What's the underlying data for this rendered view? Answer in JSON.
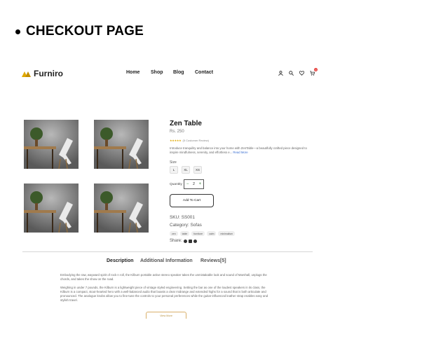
{
  "slide": {
    "title": "CHECKOUT PAGE"
  },
  "header": {
    "logo": "Furniro",
    "nav": [
      "Home",
      "Shop",
      "Blog",
      "Contact"
    ],
    "icons": [
      "user-icon",
      "search-icon",
      "heart-icon",
      "cart-icon"
    ],
    "cart_count": "0"
  },
  "product": {
    "title": "Zen Table",
    "price": "Rs. 250",
    "stars": "★★★★★",
    "reviews": "(5 Customer Review)",
    "description": "Introduce tranquility and balance into your home with ZenTable—a beautifully crafted piece designed to inspire mindfulness, serenity, and effortless e...",
    "read_more": "Read More",
    "size_label": "Size",
    "sizes": [
      "L",
      "XL",
      "XS"
    ],
    "quantity_label": "Quantity",
    "quantity": "2",
    "minus": "−",
    "plus": "+",
    "add_to_cart": "Add To Cart",
    "sku": "SKU: SS001",
    "category": "Category: Sofas",
    "tags": [
      "zen",
      "table",
      "furniture",
      "calm",
      "minimalism"
    ],
    "share_label": "Share:"
  },
  "tabs": [
    "Description",
    "Additional Information",
    "Reviews[5]"
  ],
  "description_paragraphs": [
    "Embodying the raw, wayward spirit of rock n roll, the Kilburn portable active stereo speaker takes the unmistakable look and sound of Marshall, unplugs the chords, and takes the show on the road.",
    "Weighing in under 7 pounds, the Kilburn is a lightweight piece of vintage styled engineering. Setting the bar as one of the loudest speakers in its class, the Kilburn is a compact, stout-hearted hero with a well-balanced audio that boasts a clear midrange and extended highs for a sound that is both articulate and pronounced. The analogue knobs allow you to fine-tune the controls to your personal preferences while the guitar-influenced leather strap enables easy and stylish travel."
  ],
  "more_button": "View More",
  "colors": {
    "accent": "#b7903e",
    "logo": "#e0a800",
    "badge": "#e53935"
  }
}
